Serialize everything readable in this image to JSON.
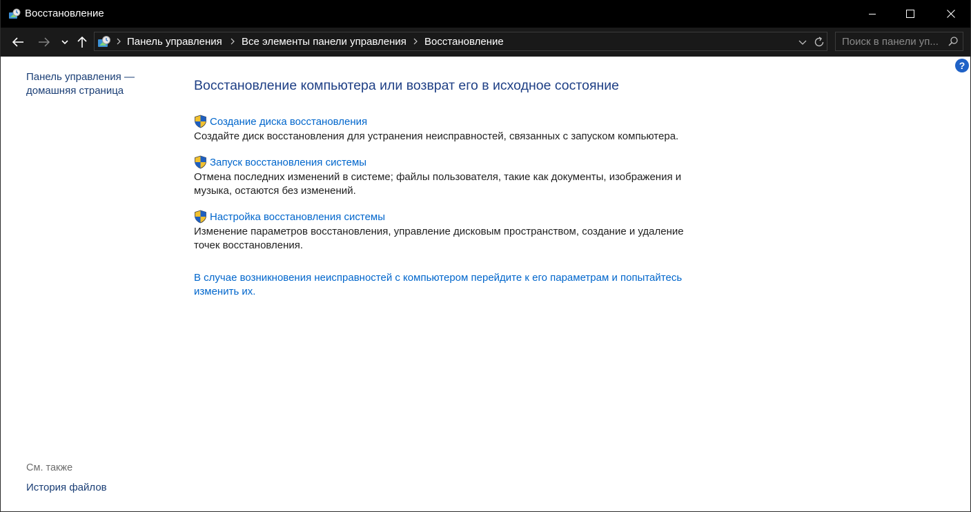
{
  "window": {
    "title": "Восстановление"
  },
  "address": {
    "crumbs": [
      "Панель управления",
      "Все элементы панели управления",
      "Восстановление"
    ]
  },
  "search": {
    "placeholder": "Поиск в панели уп..."
  },
  "left_pane": {
    "home_link": "Панель управления — домашняя страница",
    "see_also_label": "См. также",
    "see_also_items": [
      "История файлов"
    ]
  },
  "main": {
    "heading": "Восстановление компьютера или возврат его в исходное состояние",
    "tasks": [
      {
        "link": "Создание диска восстановления",
        "description": "Создайте диск восстановления для устранения неисправностей, связанных с запуском компьютера."
      },
      {
        "link": "Запуск восстановления системы",
        "description": "Отмена последних изменений в системе; файлы пользователя, такие как документы, изображения и музыка, остаются без изменений."
      },
      {
        "link": "Настройка восстановления системы",
        "description": "Изменение параметров восстановления, управление дисковым пространством, создание и удаление точек восстановления."
      }
    ],
    "troubleshoot_link": "В случае возникновения неисправностей с компьютером перейдите к его параметрам и попытайтесь изменить их."
  },
  "help": {
    "label": "?"
  },
  "colors": {
    "titlebar_bg": "#000000",
    "navbar_bg": "#1a1a1a",
    "heading": "#1e3f85",
    "link": "#0066cc",
    "left_link": "#1a3e75",
    "help_bg": "#1f62c7"
  }
}
